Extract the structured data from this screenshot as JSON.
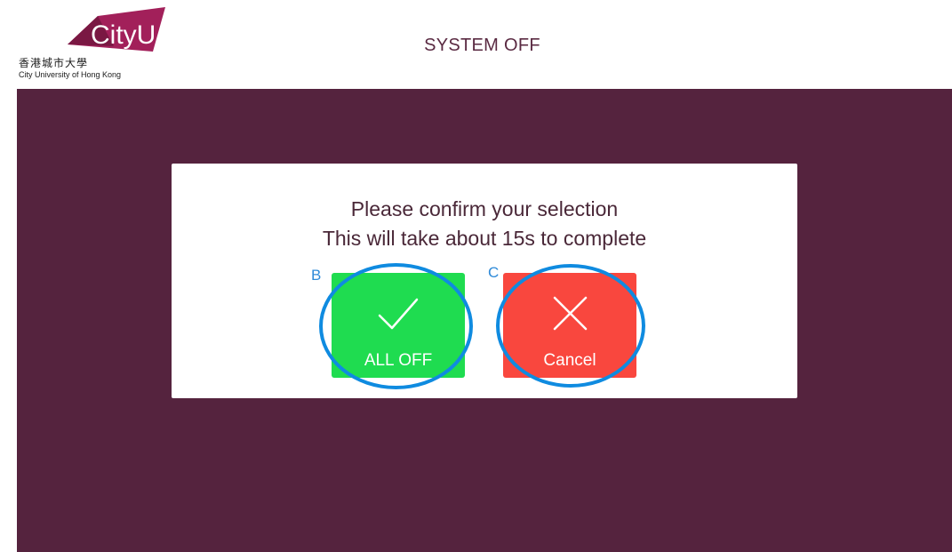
{
  "header": {
    "title": "SYSTEM OFF",
    "logo": {
      "brand": "CityU",
      "chinese_name": "香港城市大學",
      "english_name": "City University of Hong Kong"
    }
  },
  "dialog": {
    "line1": "Please confirm your selection",
    "line2": "This will take about 15s to complete",
    "buttons": [
      {
        "label": "ALL OFF",
        "icon": "checkmark-icon",
        "color": "#1fdc50",
        "marker": "B"
      },
      {
        "label": "Cancel",
        "icon": "close-icon",
        "color": "#f9473e",
        "marker": "C"
      }
    ]
  },
  "colors": {
    "background": "#55233e",
    "annotation": "#0f8be0",
    "title": "#5a2a42"
  }
}
